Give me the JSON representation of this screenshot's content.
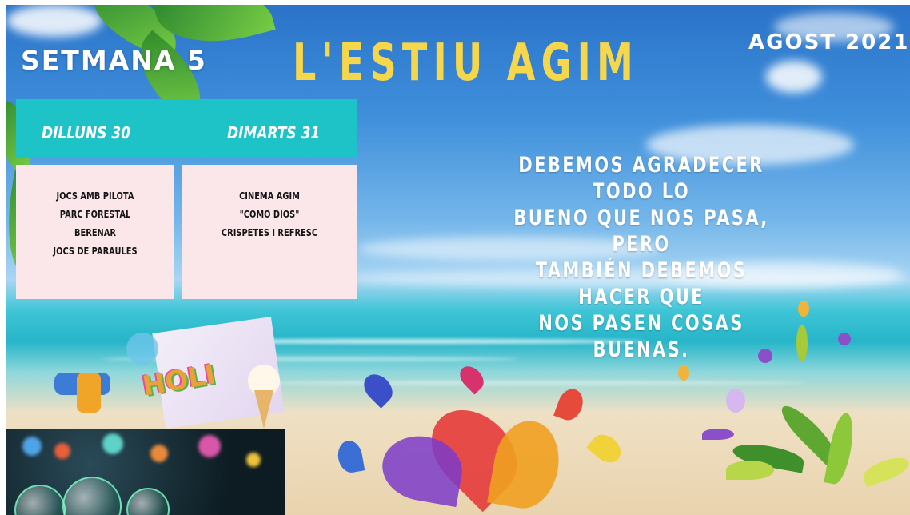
{
  "week": "SETMANA 5",
  "title": "L'ESTIU AGIM",
  "date": "AGOST 2021",
  "days": [
    {
      "label": "DILLUNS 30",
      "activities": [
        "JOCS AMB PILOTA",
        "PARC FORESTAL",
        "BERENAR",
        "JOCS DE PARAULES"
      ]
    },
    {
      "label": "DIMARTS 31",
      "activities": [
        "CINEMA AGIM",
        "\"COMO DIOS\"",
        "CRISPETES I REFRESC"
      ]
    }
  ],
  "quote": [
    "DEBEMOS AGRADECER TODO LO",
    "BUENO QUE NOS PASA, PERO",
    "TAMBIÉN DEBEMOS HACER QUE",
    "NOS PASEN COSAS BUENAS."
  ],
  "sticker_text": "HOLI",
  "colors": {
    "teal": "#1ec3c8",
    "card": "#fbe6ea",
    "title": "#f6d64a"
  }
}
